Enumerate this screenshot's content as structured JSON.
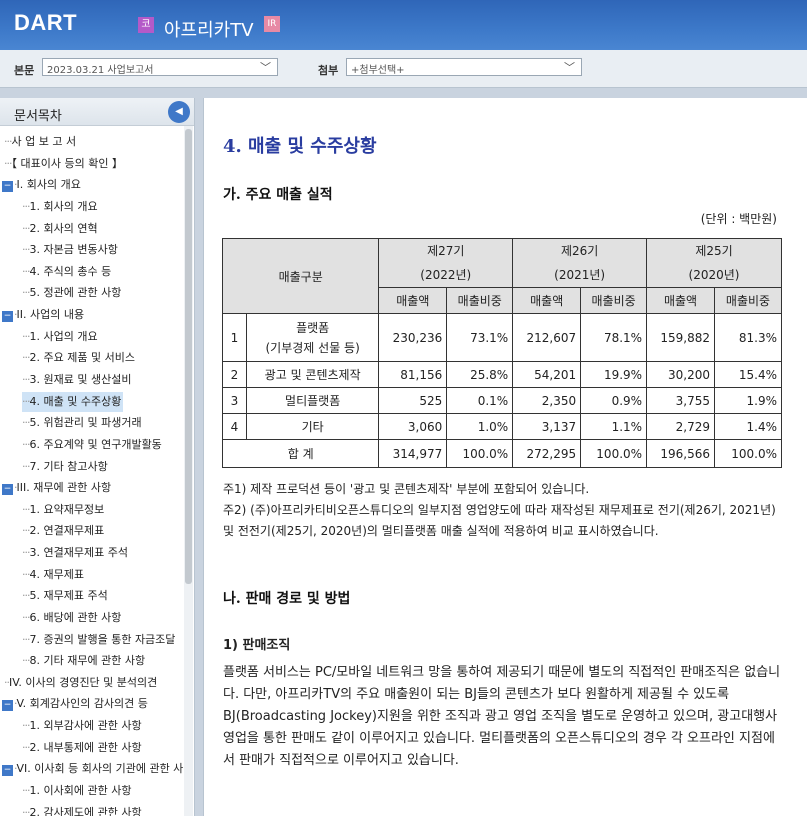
{
  "header": {
    "logo": "DART",
    "corp_badge": "코",
    "company": "아프리카TV",
    "ir_badge": "IR"
  },
  "selectbar": {
    "body_label": "본문",
    "body_value": "2023.03.21  사업보고서",
    "attach_label": "첨부",
    "attach_value": "+첨부선택+"
  },
  "sidebar": {
    "title": "문서목차",
    "items": [
      {
        "label": "사 업 보 고 서"
      },
      {
        "label": "【 대표이사 등의 확인 】"
      },
      {
        "label": "I. 회사의 개요"
      },
      {
        "label": "1. 회사의 개요"
      },
      {
        "label": "2. 회사의 연혁"
      },
      {
        "label": "3. 자본금 변동사항"
      },
      {
        "label": "4. 주식의 총수 등"
      },
      {
        "label": "5. 정관에 관한 사항"
      },
      {
        "label": "II. 사업의 내용"
      },
      {
        "label": "1. 사업의 개요"
      },
      {
        "label": "2. 주요 제품 및 서비스"
      },
      {
        "label": "3. 원재료 및 생산설비"
      },
      {
        "label": "4. 매출 및 수주상황"
      },
      {
        "label": "5. 위험관리 및 파생거래"
      },
      {
        "label": "6. 주요계약 및 연구개발활동"
      },
      {
        "label": "7. 기타 참고사항"
      },
      {
        "label": "III. 재무에 관한 사항"
      },
      {
        "label": "1. 요약재무정보"
      },
      {
        "label": "2. 연결재무제표"
      },
      {
        "label": "3. 연결재무제표 주석"
      },
      {
        "label": "4. 재무제표"
      },
      {
        "label": "5. 재무제표 주석"
      },
      {
        "label": "6. 배당에 관한 사항"
      },
      {
        "label": "7. 증권의 발행을 통한 자금조달"
      },
      {
        "label": "8. 기타 재무에 관한 사항"
      },
      {
        "label": "IV. 이사의 경영진단 및 분석의견"
      },
      {
        "label": "V. 회계감사인의 감사의견 등"
      },
      {
        "label": "1. 외부감사에 관한 사항"
      },
      {
        "label": "2. 내부통제에 관한 사항"
      },
      {
        "label": "VI. 이사회 등 회사의 기관에 관한 사"
      },
      {
        "label": "1. 이사회에 관한 사항"
      },
      {
        "label": "2. 감사제도에 관한 사항"
      }
    ]
  },
  "content": {
    "title": "4. 매출 및 수주상황",
    "section_a": "가. 주요 매출 실적",
    "unit": "(단위 : 백만원)",
    "table": {
      "corner": "매출구분",
      "periods": [
        {
          "name": "제27기",
          "year": "(2022년)"
        },
        {
          "name": "제26기",
          "year": "(2021년)"
        },
        {
          "name": "제25기",
          "year": "(2020년)"
        }
      ],
      "sub_amount": "매출액",
      "sub_ratio": "매출비중",
      "rows": [
        {
          "no": "1",
          "name": "플랫폼",
          "name2": "(기부경제 선물 등)",
          "cells": [
            "230,236",
            "73.1%",
            "212,607",
            "78.1%",
            "159,882",
            "81.3%"
          ]
        },
        {
          "no": "2",
          "name": "광고 및 콘텐츠제작",
          "name2": "",
          "cells": [
            "81,156",
            "25.8%",
            "54,201",
            "19.9%",
            "30,200",
            "15.4%"
          ]
        },
        {
          "no": "3",
          "name": "멀티플랫폼",
          "name2": "",
          "cells": [
            "525",
            "0.1%",
            "2,350",
            "0.9%",
            "3,755",
            "1.9%"
          ]
        },
        {
          "no": "4",
          "name": "기타",
          "name2": "",
          "cells": [
            "3,060",
            "1.0%",
            "3,137",
            "1.1%",
            "2,729",
            "1.4%"
          ]
        }
      ],
      "total_label": "합 계",
      "total_cells": [
        "314,977",
        "100.0%",
        "272,295",
        "100.0%",
        "196,566",
        "100.0%"
      ]
    },
    "note1": "주1) 제작 프로덕션 등이 '광고 및 콘텐츠제작' 부분에 포함되어 있습니다.",
    "note2": "주2) (주)아프리카티비오픈스튜디오의 일부지점 영업양도에 따라 재작성된 재무제표로 전기(제26기, 2021년)및 전전기(제25기, 2020년)의 멀티플랫폼 매출 실적에 적용하여 비교 표시하였습니다.",
    "section_b": "나. 판매 경로 및 방법",
    "sub_1": "1) 판매조직",
    "paragraph": "플랫폼 서비스는 PC/모바일 네트워크 망을 통하여 제공되기 때문에 별도의 직접적인 판매조직은 없습니다. 다만, 아프리카TV의 주요 매출원이 되는 BJ들의 콘텐츠가 보다 원활하게 제공될 수 있도록 BJ(Broadcasting Jockey)지원을 위한 조직과 광고 영업 조직을 별도로 운영하고 있으며, 광고대행사 영업을 통한 판매도 같이 이루어지고 있습니다. 멀티플랫폼의 오픈스튜디오의 경우 각 오프라인 지점에서 판매가 직접적으로 이루어지고 있습니다."
  }
}
